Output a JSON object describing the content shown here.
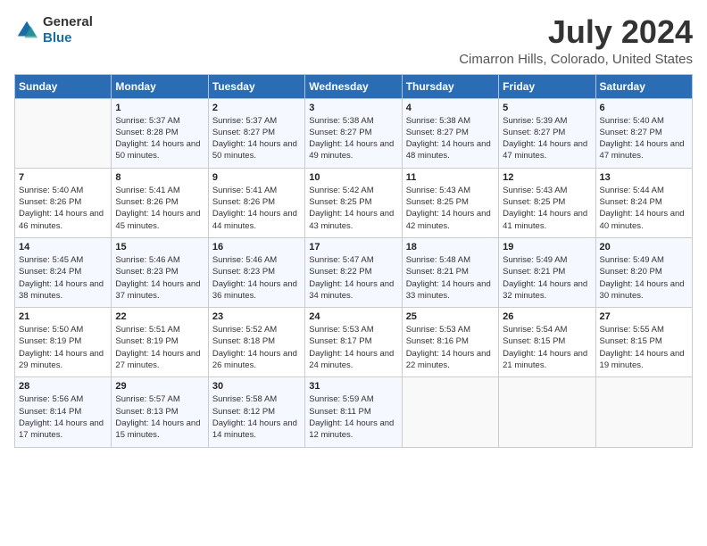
{
  "header": {
    "logo": {
      "general": "General",
      "blue": "Blue"
    },
    "title": "July 2024",
    "location": "Cimarron Hills, Colorado, United States"
  },
  "weekdays": [
    "Sunday",
    "Monday",
    "Tuesday",
    "Wednesday",
    "Thursday",
    "Friday",
    "Saturday"
  ],
  "weeks": [
    [
      {
        "day": "",
        "sunrise": "",
        "sunset": "",
        "daylight": ""
      },
      {
        "day": "1",
        "sunrise": "Sunrise: 5:37 AM",
        "sunset": "Sunset: 8:28 PM",
        "daylight": "Daylight: 14 hours and 50 minutes."
      },
      {
        "day": "2",
        "sunrise": "Sunrise: 5:37 AM",
        "sunset": "Sunset: 8:27 PM",
        "daylight": "Daylight: 14 hours and 50 minutes."
      },
      {
        "day": "3",
        "sunrise": "Sunrise: 5:38 AM",
        "sunset": "Sunset: 8:27 PM",
        "daylight": "Daylight: 14 hours and 49 minutes."
      },
      {
        "day": "4",
        "sunrise": "Sunrise: 5:38 AM",
        "sunset": "Sunset: 8:27 PM",
        "daylight": "Daylight: 14 hours and 48 minutes."
      },
      {
        "day": "5",
        "sunrise": "Sunrise: 5:39 AM",
        "sunset": "Sunset: 8:27 PM",
        "daylight": "Daylight: 14 hours and 47 minutes."
      },
      {
        "day": "6",
        "sunrise": "Sunrise: 5:40 AM",
        "sunset": "Sunset: 8:27 PM",
        "daylight": "Daylight: 14 hours and 47 minutes."
      }
    ],
    [
      {
        "day": "7",
        "sunrise": "Sunrise: 5:40 AM",
        "sunset": "Sunset: 8:26 PM",
        "daylight": "Daylight: 14 hours and 46 minutes."
      },
      {
        "day": "8",
        "sunrise": "Sunrise: 5:41 AM",
        "sunset": "Sunset: 8:26 PM",
        "daylight": "Daylight: 14 hours and 45 minutes."
      },
      {
        "day": "9",
        "sunrise": "Sunrise: 5:41 AM",
        "sunset": "Sunset: 8:26 PM",
        "daylight": "Daylight: 14 hours and 44 minutes."
      },
      {
        "day": "10",
        "sunrise": "Sunrise: 5:42 AM",
        "sunset": "Sunset: 8:25 PM",
        "daylight": "Daylight: 14 hours and 43 minutes."
      },
      {
        "day": "11",
        "sunrise": "Sunrise: 5:43 AM",
        "sunset": "Sunset: 8:25 PM",
        "daylight": "Daylight: 14 hours and 42 minutes."
      },
      {
        "day": "12",
        "sunrise": "Sunrise: 5:43 AM",
        "sunset": "Sunset: 8:25 PM",
        "daylight": "Daylight: 14 hours and 41 minutes."
      },
      {
        "day": "13",
        "sunrise": "Sunrise: 5:44 AM",
        "sunset": "Sunset: 8:24 PM",
        "daylight": "Daylight: 14 hours and 40 minutes."
      }
    ],
    [
      {
        "day": "14",
        "sunrise": "Sunrise: 5:45 AM",
        "sunset": "Sunset: 8:24 PM",
        "daylight": "Daylight: 14 hours and 38 minutes."
      },
      {
        "day": "15",
        "sunrise": "Sunrise: 5:46 AM",
        "sunset": "Sunset: 8:23 PM",
        "daylight": "Daylight: 14 hours and 37 minutes."
      },
      {
        "day": "16",
        "sunrise": "Sunrise: 5:46 AM",
        "sunset": "Sunset: 8:23 PM",
        "daylight": "Daylight: 14 hours and 36 minutes."
      },
      {
        "day": "17",
        "sunrise": "Sunrise: 5:47 AM",
        "sunset": "Sunset: 8:22 PM",
        "daylight": "Daylight: 14 hours and 34 minutes."
      },
      {
        "day": "18",
        "sunrise": "Sunrise: 5:48 AM",
        "sunset": "Sunset: 8:21 PM",
        "daylight": "Daylight: 14 hours and 33 minutes."
      },
      {
        "day": "19",
        "sunrise": "Sunrise: 5:49 AM",
        "sunset": "Sunset: 8:21 PM",
        "daylight": "Daylight: 14 hours and 32 minutes."
      },
      {
        "day": "20",
        "sunrise": "Sunrise: 5:49 AM",
        "sunset": "Sunset: 8:20 PM",
        "daylight": "Daylight: 14 hours and 30 minutes."
      }
    ],
    [
      {
        "day": "21",
        "sunrise": "Sunrise: 5:50 AM",
        "sunset": "Sunset: 8:19 PM",
        "daylight": "Daylight: 14 hours and 29 minutes."
      },
      {
        "day": "22",
        "sunrise": "Sunrise: 5:51 AM",
        "sunset": "Sunset: 8:19 PM",
        "daylight": "Daylight: 14 hours and 27 minutes."
      },
      {
        "day": "23",
        "sunrise": "Sunrise: 5:52 AM",
        "sunset": "Sunset: 8:18 PM",
        "daylight": "Daylight: 14 hours and 26 minutes."
      },
      {
        "day": "24",
        "sunrise": "Sunrise: 5:53 AM",
        "sunset": "Sunset: 8:17 PM",
        "daylight": "Daylight: 14 hours and 24 minutes."
      },
      {
        "day": "25",
        "sunrise": "Sunrise: 5:53 AM",
        "sunset": "Sunset: 8:16 PM",
        "daylight": "Daylight: 14 hours and 22 minutes."
      },
      {
        "day": "26",
        "sunrise": "Sunrise: 5:54 AM",
        "sunset": "Sunset: 8:15 PM",
        "daylight": "Daylight: 14 hours and 21 minutes."
      },
      {
        "day": "27",
        "sunrise": "Sunrise: 5:55 AM",
        "sunset": "Sunset: 8:15 PM",
        "daylight": "Daylight: 14 hours and 19 minutes."
      }
    ],
    [
      {
        "day": "28",
        "sunrise": "Sunrise: 5:56 AM",
        "sunset": "Sunset: 8:14 PM",
        "daylight": "Daylight: 14 hours and 17 minutes."
      },
      {
        "day": "29",
        "sunrise": "Sunrise: 5:57 AM",
        "sunset": "Sunset: 8:13 PM",
        "daylight": "Daylight: 14 hours and 15 minutes."
      },
      {
        "day": "30",
        "sunrise": "Sunrise: 5:58 AM",
        "sunset": "Sunset: 8:12 PM",
        "daylight": "Daylight: 14 hours and 14 minutes."
      },
      {
        "day": "31",
        "sunrise": "Sunrise: 5:59 AM",
        "sunset": "Sunset: 8:11 PM",
        "daylight": "Daylight: 14 hours and 12 minutes."
      },
      {
        "day": "",
        "sunrise": "",
        "sunset": "",
        "daylight": ""
      },
      {
        "day": "",
        "sunrise": "",
        "sunset": "",
        "daylight": ""
      },
      {
        "day": "",
        "sunrise": "",
        "sunset": "",
        "daylight": ""
      }
    ]
  ]
}
